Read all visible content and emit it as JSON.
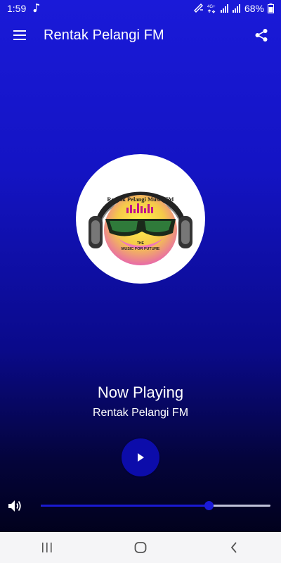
{
  "status_bar": {
    "time": "1:59",
    "battery": "68%",
    "network": "4G+",
    "icons": [
      "music-note-icon",
      "wifi-calling-icon",
      "4g-icon",
      "signal-icon",
      "signal-icon",
      "battery-icon"
    ]
  },
  "app_bar": {
    "title": "Rentak Pelangi FM",
    "menu_icon": "hamburger-menu-icon",
    "share_icon": "share-icon"
  },
  "artwork": {
    "logo_text": "Rentak Pelangi Music FM",
    "tagline_1": "THE",
    "tagline_2": "MUSIC FOR FUTURE"
  },
  "player": {
    "heading": "Now Playing",
    "station": "Rentak Pelangi FM",
    "play_icon": "play-icon",
    "volume_icon": "volume-icon",
    "volume_level": 0.73
  },
  "nav_bar": {
    "icons": [
      "recent-apps-icon",
      "home-icon",
      "back-icon"
    ]
  },
  "colors": {
    "accent": "#1a1ad8",
    "play_button": "#0c0caa",
    "nav_bar_bg": "#f5f5f7"
  }
}
